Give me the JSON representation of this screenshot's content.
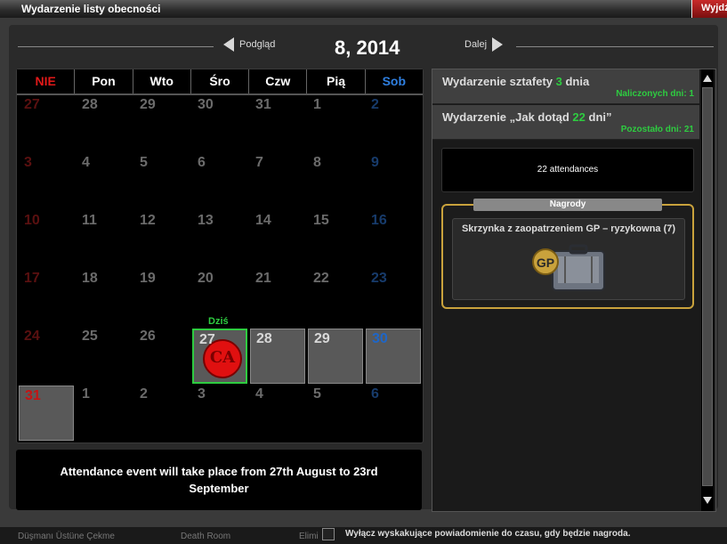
{
  "window": {
    "title": "Wydarzenie listy obecności",
    "exit_label": "Wyjdź"
  },
  "nav": {
    "prev_label": "Podgląd",
    "next_label": "Dalej",
    "month_label": "8, 2014"
  },
  "calendar": {
    "days_of_week": [
      "NIE",
      "Pon",
      "Wto",
      "Śro",
      "Czw",
      "Pią",
      "Sob"
    ],
    "today_label": "Dziś",
    "stamp_text": "CA",
    "weeks": [
      [
        "27",
        "28",
        "29",
        "30",
        "31",
        "1",
        "2"
      ],
      [
        "3",
        "4",
        "5",
        "6",
        "7",
        "8",
        "9"
      ],
      [
        "10",
        "11",
        "12",
        "13",
        "14",
        "15",
        "16"
      ],
      [
        "17",
        "18",
        "19",
        "20",
        "21",
        "22",
        "23"
      ],
      [
        "24",
        "25",
        "26",
        "27",
        "28",
        "29",
        "30"
      ],
      [
        "31",
        "1",
        "2",
        "3",
        "4",
        "5",
        "6"
      ]
    ]
  },
  "message": "Attendance event will take place from 27th August to 23rd September",
  "events": [
    {
      "prefix": "Wydarzenie sztafety ",
      "value": "3",
      "suffix": " dnia",
      "sub": "Naliczonych dni: 1"
    },
    {
      "prefix": "Wydarzenie „Jak dotąd ",
      "value": "22",
      "suffix": " dni”",
      "sub": "Pozostało dni: 21"
    }
  ],
  "attendances": "22 attendances",
  "rewards": {
    "header": "Nagrody",
    "item_name": "Skrzynka z zaopatrzeniem GP – ryzykowna (7)",
    "icon_text": "GP"
  },
  "footer": {
    "items": [
      "Düşmanı Üstüne Çekme",
      "Death Room",
      "Elimi"
    ],
    "checkbox_label": "Wyłącz wyskakujące powiadomienie do czasu, gdy będzie nagroda."
  },
  "colors": {
    "sunday": "#c41414",
    "saturday": "#1e66c8",
    "green": "#2ecc40",
    "gold": "#c9a23c"
  }
}
